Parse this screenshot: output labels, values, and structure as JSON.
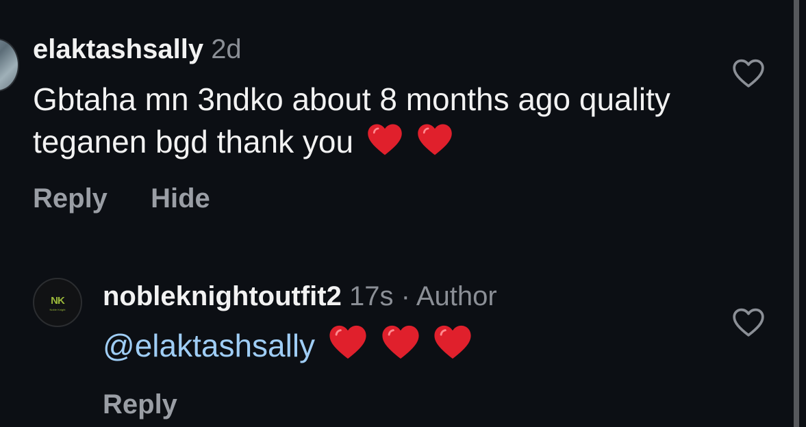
{
  "comment": {
    "username": "elaktashsally",
    "time": "2d",
    "text": "Gbtaha mn 3ndko about 8 months ago quality teganen bgd thank you",
    "reply_label": "Reply",
    "hide_label": "Hide",
    "like_icon": "heart-outline-icon"
  },
  "reply": {
    "username": "nobleknightoutfit2",
    "time": "17s",
    "separator": "·",
    "badge": "Author",
    "mention": "@elaktashsally",
    "reply_label": "Reply",
    "like_icon": "heart-outline-icon",
    "avatar_logo": "NK",
    "avatar_logo_sub": "Noble Knight"
  },
  "colors": {
    "background": "#0c0f14",
    "text": "#f2f2f2",
    "muted": "#8b8f96",
    "mention": "#9fcdf5",
    "heart": "#e0202c",
    "logo": "#9bb83a"
  }
}
